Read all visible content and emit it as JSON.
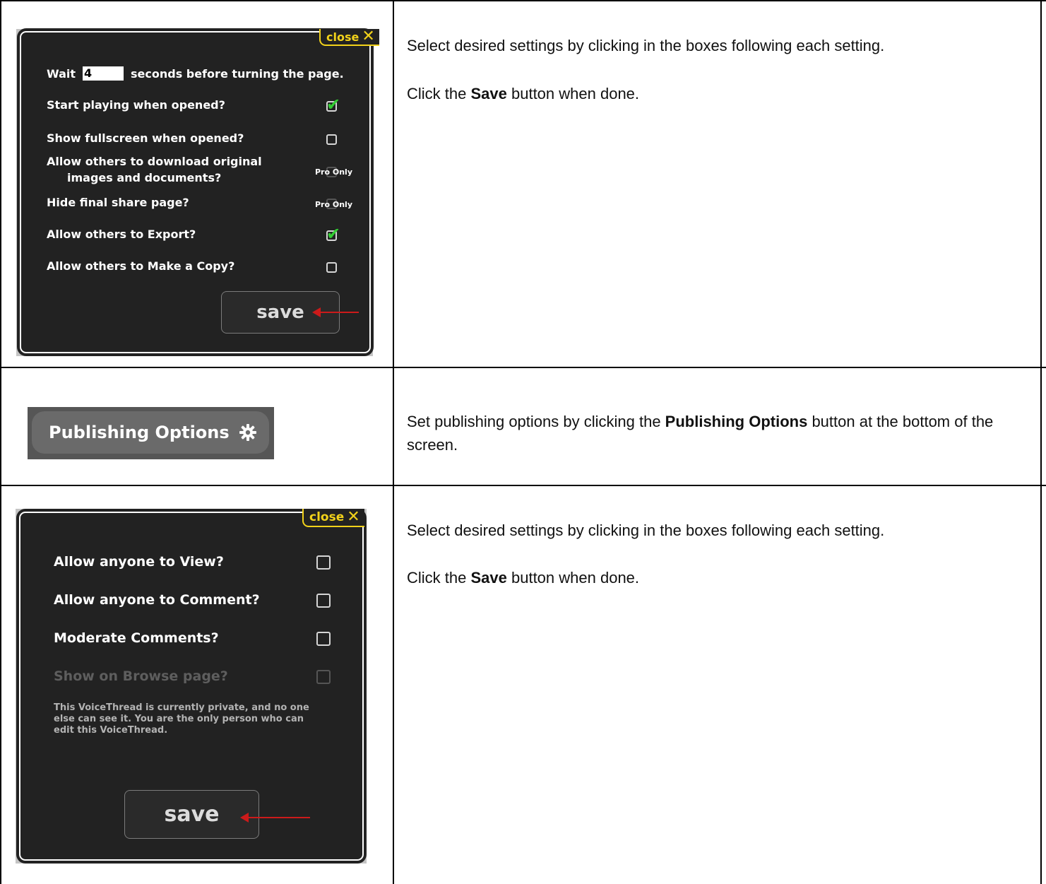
{
  "rows": [
    {
      "instruction": [
        "Select desired settings by clicking in the boxes following each setting.",
        {
          "before": "Click the ",
          "bold": "Save",
          "after": " button when done."
        }
      ]
    },
    {
      "instruction": [
        {
          "before": "Set publishing options by clicking the ",
          "bold": "Publishing Options",
          "after": " button at the bottom of the screen."
        }
      ]
    },
    {
      "instruction": [
        "Select desired settings by clicking in the boxes following each setting.",
        {
          "before": "Click the ",
          "bold": "Save",
          "after": " button when done."
        }
      ]
    }
  ],
  "playback_dialog": {
    "close_label": "close",
    "close_icon": "close-x-icon",
    "wait_prefix": "Wait",
    "wait_value": "4",
    "wait_suffix": "seconds before turning the page.",
    "options": [
      {
        "label": "Start playing when opened?",
        "state": "checked"
      },
      {
        "label": "Show fullscreen when opened?",
        "state": "unchecked"
      },
      {
        "label": "Allow others to download original",
        "label2": "images and documents?",
        "state": "pro",
        "pro_text": "Pro Only"
      },
      {
        "label": "Hide final share page?",
        "state": "pro",
        "pro_text": "Pro Only"
      },
      {
        "label": "Allow others to Export?",
        "state": "checked"
      },
      {
        "label": "Allow others to Make a Copy?",
        "state": "unchecked"
      }
    ],
    "save_label": "save"
  },
  "publishing_button": {
    "label": "Publishing Options",
    "icon": "gear-icon"
  },
  "publishing_dialog": {
    "close_label": "close",
    "options": [
      {
        "label": "Allow anyone to View?",
        "state": "unchecked"
      },
      {
        "label": "Allow anyone to Comment?",
        "state": "unchecked"
      },
      {
        "label": "Moderate Comments?",
        "state": "unchecked"
      },
      {
        "label": "Show on Browse page?",
        "state": "disabled"
      }
    ],
    "note_lines": [
      "This VoiceThread is currently private, and no one",
      "else can see it. You are the only person who can",
      "edit this VoiceThread."
    ],
    "save_label": "save"
  },
  "colors": {
    "panel": "#222222",
    "close_accent": "#f2d21a",
    "check_green": "#33cc33",
    "arrow_red": "#cc1a1a"
  }
}
